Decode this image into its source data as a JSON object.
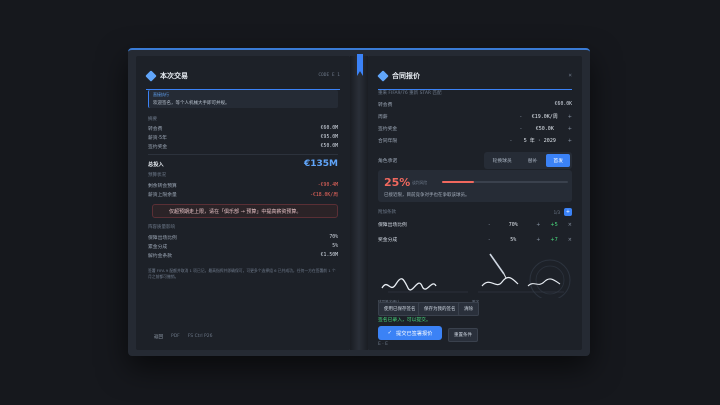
{
  "left": {
    "title": "本次交易",
    "corner": "CODE E 1",
    "notice_tag": "直接执行",
    "notice_text": "欢迎签名，等个人机械大手即可并规。",
    "summary_label": "摘要",
    "rows": [
      {
        "label": "转会费",
        "value": "€60.0M"
      },
      {
        "label": "薪资·5年",
        "value": "€95.0M"
      },
      {
        "label": "签约奖金",
        "value": "€50.0M"
      }
    ],
    "total_label": "总投入",
    "total_value": "€135M",
    "budget_label": "预算状况",
    "budget_rows": [
      {
        "label": "剩余转会预算",
        "value": "-€90.4M"
      },
      {
        "label": "薪资上限余量",
        "value": "-€18.0K/周"
      }
    ],
    "warning": "仅超预期走上限，请在「俱乐部 → 预算」中提高薪资预算。",
    "squad_label": "阵容质量影响",
    "squad_rows": [
      {
        "label": "保障出场比例",
        "value": "70%"
      },
      {
        "label": "累金分成",
        "value": "5%"
      },
      {
        "label": "解约金条款",
        "value": "€1.50M"
      }
    ],
    "note": "签署 FIFA 9 配额并取消 1 项已记，最高指挥并即确保可，可更多个选择组 6 已共成功，任何一方在签署前 1 个月之前都可撤销。",
    "footer": [
      "返回",
      "PDF",
      "FS Ctrl P26"
    ]
  },
  "right": {
    "title": "合同报价",
    "close": "×",
    "subtitle": "重来 FIFA9/76 重新 STAR 匹配",
    "rows": [
      {
        "label": "转会费",
        "value": "€60.0K"
      },
      {
        "label": "周薪",
        "value": "€19.0K/周"
      },
      {
        "label": "签约奖金",
        "value": "€50.0K"
      },
      {
        "label": "合同年限",
        "value": "5 年 · 2029"
      }
    ],
    "role_label": "角色承诺",
    "roles": [
      "轮换球员",
      "替补",
      "首发"
    ],
    "risk_pct": "25%",
    "risk_value": 0.25,
    "risk_label": "谈判风险",
    "risk_msg": "已接近限，目前竞争对手也在争取该球员。",
    "clause_label": "附加条款",
    "clause_counter": "1/3",
    "clause_add": "+",
    "clauses": [
      {
        "label": "保障出场比例",
        "value": "70%",
        "delta": "+5"
      },
      {
        "label": "奖金分成",
        "value": "5%",
        "delta": "+7"
      }
    ],
    "sig_label_left": "球员签名确认",
    "sig_label_right": "签字",
    "btns": [
      "使用已保存签名",
      "保存为我的签名",
      "清除"
    ],
    "status": "签名已录入，可以提交。",
    "submit": "提交已签署报价",
    "secondary": "重置条件",
    "footer": "E · E"
  },
  "colors": {
    "accent": "#3b82f6",
    "danger": "#f0685e",
    "ok": "#4ade80"
  }
}
